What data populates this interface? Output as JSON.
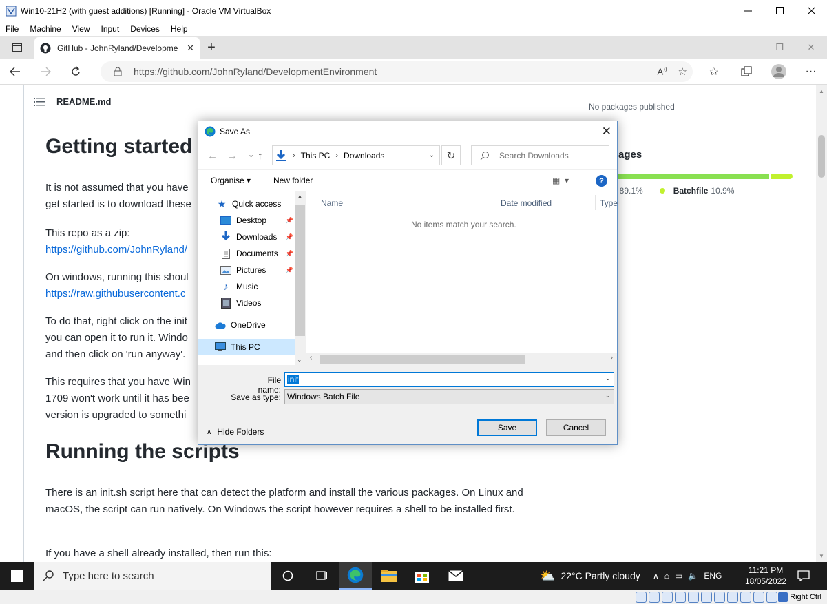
{
  "vbox": {
    "title": "Win10-21H2 (with guest additions) [Running] - Oracle VM VirtualBox",
    "menu": [
      "File",
      "Machine",
      "View",
      "Input",
      "Devices",
      "Help"
    ],
    "hostkey": "Right Ctrl"
  },
  "browser": {
    "tab_title": "GitHub - JohnRyland/DevelopmentEnvironment",
    "url": "https://github.com/JohnRyland/DevelopmentEnvironment"
  },
  "page": {
    "readme_label": "README.md",
    "h1_getting_started": "Getting started",
    "p1": "It is not assumed that you have",
    "p1b": "get started is to download these",
    "p2": "This repo as a zip:",
    "p2_link": "https://github.com/JohnRyland/",
    "p3": "On windows, running this shoul",
    "p3_link": "https://raw.githubusercontent.c",
    "p4a": "To do that, right click on the init",
    "p4b": "you can open it to run it. Windo",
    "p4c": "and then click on 'run anyway'.",
    "p5a": "This requires that you have Win",
    "p5b": "1709 won't work until it has bee",
    "p5c": "version is upgraded to somethi",
    "h1_running": "Running the scripts",
    "p6": "There is an init.sh script here that can detect the platform and install the various packages. On Linux and macOS, the script can run natively. On Windows the script however requires a shell to be installed first.",
    "p7": "If you have a shell already installed, then run this:"
  },
  "sidebar": {
    "no_packages": "No packages published",
    "languages_heading": "ages",
    "languages": [
      {
        "name": "ll",
        "percent": "89.1%",
        "value": 89.1,
        "color": "#89e051"
      },
      {
        "name": "Batchfile",
        "percent": "10.9%",
        "value": 10.9,
        "color": "#c1f12e"
      }
    ]
  },
  "dialog": {
    "title": "Save As",
    "breadcrumb": [
      "This PC",
      "Downloads"
    ],
    "search_placeholder": "Search Downloads",
    "organise": "Organise",
    "new_folder": "New folder",
    "nav_items": [
      {
        "label": "Quick access",
        "icon": "star-icon",
        "pinned": false
      },
      {
        "label": "Desktop",
        "icon": "desktop-icon",
        "pinned": true
      },
      {
        "label": "Downloads",
        "icon": "download-icon",
        "pinned": true
      },
      {
        "label": "Documents",
        "icon": "documents-icon",
        "pinned": true
      },
      {
        "label": "Pictures",
        "icon": "pictures-icon",
        "pinned": true
      },
      {
        "label": "Music",
        "icon": "music-icon",
        "pinned": false
      },
      {
        "label": "Videos",
        "icon": "videos-icon",
        "pinned": false
      },
      {
        "label": "OneDrive",
        "icon": "cloud-icon",
        "pinned": false
      },
      {
        "label": "This PC",
        "icon": "computer-icon",
        "pinned": false
      }
    ],
    "columns": [
      "Name",
      "Date modified",
      "Type"
    ],
    "empty_message": "No items match your search.",
    "file_name_label": "File name:",
    "file_name_value": "init",
    "save_type_label": "Save as type:",
    "save_type_value": "Windows Batch File",
    "hide_folders": "Hide Folders",
    "save_button": "Save",
    "cancel_button": "Cancel"
  },
  "taskbar": {
    "search_placeholder": "Type here to search",
    "weather": "22°C  Partly cloudy",
    "language": "ENG",
    "time": "11:21 PM",
    "date": "18/05/2022"
  }
}
